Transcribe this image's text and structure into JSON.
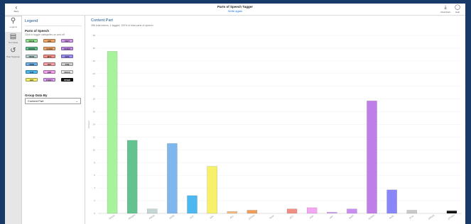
{
  "header": {
    "back_label": "Back",
    "title": "Parts of Speech Tagger",
    "subtitle": "Write again",
    "download_label": "Download",
    "help_label": "Help"
  },
  "rail": {
    "items": [
      {
        "label": "Legend"
      },
      {
        "label": "Text Stats"
      },
      {
        "label": "Past Taggings"
      }
    ]
  },
  "legend": {
    "title": "Legend",
    "pos_heading": "Parts of Speech",
    "pos_hint": "Click to toggle categories on and off",
    "chips": [
      {
        "label": "NOUN",
        "color": "#98e58f"
      },
      {
        "label": "ADJ",
        "color": "#f1a76a"
      },
      {
        "label": "PART",
        "color": "#d59af0"
      },
      {
        "label": "PROPN",
        "color": "#62c38f"
      },
      {
        "label": "CCONJ",
        "color": "#f0a869"
      },
      {
        "label": "SCONJ",
        "color": "#c58cf0"
      },
      {
        "label": "PRON",
        "color": "#b7d0cf"
      },
      {
        "label": "INTJ",
        "color": "#f48e82"
      },
      {
        "label": "NUM",
        "color": "#9a90f7"
      },
      {
        "label": "VERB",
        "color": "#6fb0e8"
      },
      {
        "label": "DET",
        "color": "#f3a0a6"
      },
      {
        "label": "SYM",
        "color": "#cfcfcf"
      },
      {
        "label": "AUX",
        "color": "#4db8f0"
      },
      {
        "label": "ADP",
        "color": "#f4a0ee"
      },
      {
        "label": "SPACE",
        "color": "#e8e8e8"
      },
      {
        "label": "ADV",
        "color": "#f4ef69"
      },
      {
        "label": "PUNCT",
        "color": "#e3a0f3"
      },
      {
        "label": "OTHER",
        "color": "#111111"
      }
    ],
    "group_heading": "Group Data By",
    "group_value": "Content Part"
  },
  "chart_data": {
    "type": "bar",
    "title": "Content Part",
    "note": "286 total tokens, 1 tagged; 100% of total parts of speech",
    "ylabel": "Percent",
    "ylim": [
      0,
      28
    ],
    "yticks": [
      0,
      2,
      4,
      6,
      8,
      10,
      12,
      14,
      16,
      18,
      20,
      22,
      24,
      26,
      28
    ],
    "categories": [
      "NOUN",
      "PROPN",
      "PRON",
      "VERB",
      "AUX",
      "ADV",
      "ADJ",
      "CCONJ",
      "NUM",
      "INTJ",
      "ADP",
      "DET",
      "PART",
      "SCONJ",
      "NUM",
      "SYM",
      "SPACE",
      "OTHER"
    ],
    "values": [
      25.5,
      11.5,
      0.7,
      11.0,
      2.8,
      7.4,
      0.3,
      0.5,
      0,
      0.7,
      0.9,
      0.2,
      0.7,
      17.7,
      3.7,
      0.5,
      0,
      0.4
    ],
    "colors": [
      "#a6f39b",
      "#62c38f",
      "#c4d6d4",
      "#7fb7ec",
      "#4db8f0",
      "#f6f06b",
      "#f4b97e",
      "#ee9d5a",
      "#9a90f7",
      "#f08f85",
      "#f4a7f1",
      "#d6a4f3",
      "#c98ef2",
      "#c07ee8",
      "#8986f9",
      "#c9c9c9",
      "#e8e8e8",
      "#111111"
    ]
  }
}
